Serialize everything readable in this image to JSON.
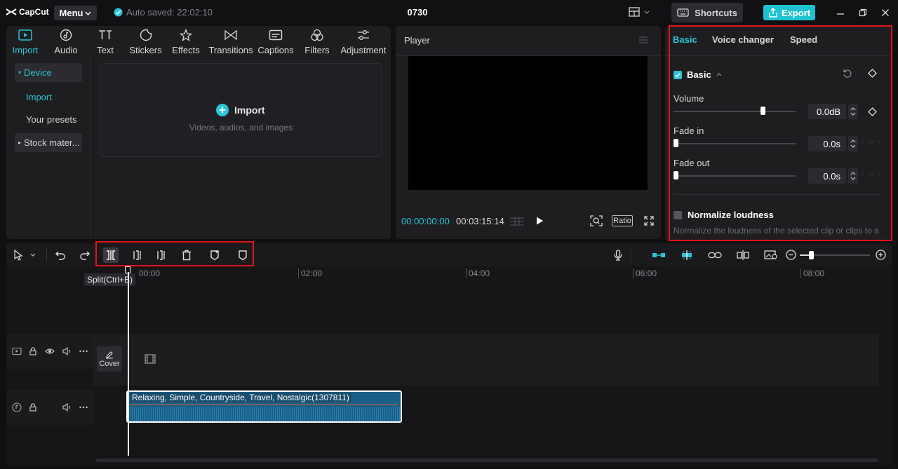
{
  "app": {
    "logo": "CapCut",
    "menu_label": "Menu",
    "autosave": "Auto saved: 22:02:10",
    "project_title": "0730",
    "shortcuts_label": "Shortcuts",
    "export_label": "Export"
  },
  "media_tabs": [
    {
      "label": "Import",
      "icon": "import-icon",
      "active": true
    },
    {
      "label": "Audio",
      "icon": "audio-icon"
    },
    {
      "label": "Text",
      "icon": "text-icon"
    },
    {
      "label": "Stickers",
      "icon": "stickers-icon"
    },
    {
      "label": "Effects",
      "icon": "effects-icon"
    },
    {
      "label": "Transitions",
      "icon": "transitions-icon"
    },
    {
      "label": "Captions",
      "icon": "captions-icon"
    },
    {
      "label": "Filters",
      "icon": "filters-icon"
    },
    {
      "label": "Adjustment",
      "icon": "adjustment-icon"
    }
  ],
  "sidebar": {
    "device": "Device",
    "import": "Import",
    "presets": "Your presets",
    "stock": "Stock mater..."
  },
  "dropzone": {
    "title": "Import",
    "subtitle": "Videos, audios, and images"
  },
  "player": {
    "title": "Player",
    "current_time": "00:00:00:00",
    "total_time": "00:03:15:14",
    "ratio_label": "Ratio"
  },
  "props": {
    "tabs": [
      "Basic",
      "Voice changer",
      "Speed"
    ],
    "section_title": "Basic",
    "volume_label": "Volume",
    "volume_value": "0.0dB",
    "volume_level": 0.74,
    "fadein_label": "Fade in",
    "fadein_value": "0.0s",
    "fadein_level": 0,
    "fadeout_label": "Fade out",
    "fadeout_value": "0.0s",
    "fadeout_level": 0,
    "normalize_label": "Normalize loudness",
    "normalize_desc": "Normalize the loudness of the selected clip or clips to a"
  },
  "timeline": {
    "tooltip": "Split(Ctrl+B)",
    "ruler": [
      "00:00",
      "02:00",
      "04:00",
      "06:00",
      "08:00"
    ],
    "cover_label": "Cover",
    "clip_title": "Relaxing, Simple, Countryside, Travel, Nostalgic(1307811)"
  },
  "colors": {
    "accent": "#2bc4d5",
    "highlight": "#e3131b",
    "audio_clip": "#1b5f86"
  }
}
